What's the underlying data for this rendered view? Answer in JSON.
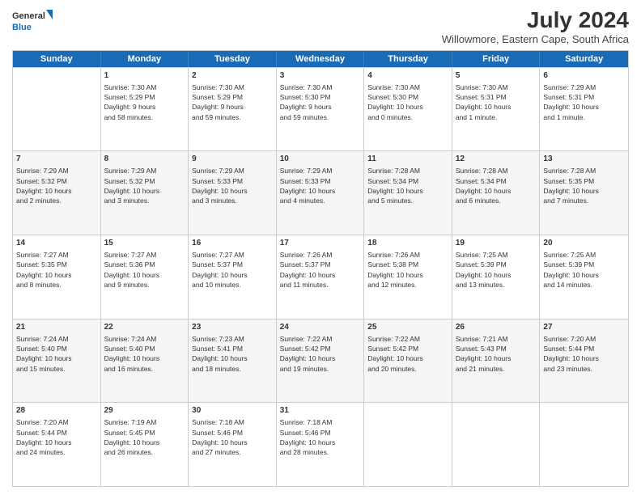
{
  "header": {
    "logo": {
      "line1": "General",
      "line2": "Blue"
    },
    "title": "July 2024",
    "location": "Willowmore, Eastern Cape, South Africa"
  },
  "days_of_week": [
    "Sunday",
    "Monday",
    "Tuesday",
    "Wednesday",
    "Thursday",
    "Friday",
    "Saturday"
  ],
  "weeks": [
    [
      {
        "day": "",
        "info": ""
      },
      {
        "day": "1",
        "info": "Sunrise: 7:30 AM\nSunset: 5:29 PM\nDaylight: 9 hours\nand 58 minutes."
      },
      {
        "day": "2",
        "info": "Sunrise: 7:30 AM\nSunset: 5:29 PM\nDaylight: 9 hours\nand 59 minutes."
      },
      {
        "day": "3",
        "info": "Sunrise: 7:30 AM\nSunset: 5:30 PM\nDaylight: 9 hours\nand 59 minutes."
      },
      {
        "day": "4",
        "info": "Sunrise: 7:30 AM\nSunset: 5:30 PM\nDaylight: 10 hours\nand 0 minutes."
      },
      {
        "day": "5",
        "info": "Sunrise: 7:30 AM\nSunset: 5:31 PM\nDaylight: 10 hours\nand 1 minute."
      },
      {
        "day": "6",
        "info": "Sunrise: 7:29 AM\nSunset: 5:31 PM\nDaylight: 10 hours\nand 1 minute."
      }
    ],
    [
      {
        "day": "7",
        "info": "Sunrise: 7:29 AM\nSunset: 5:32 PM\nDaylight: 10 hours\nand 2 minutes."
      },
      {
        "day": "8",
        "info": "Sunrise: 7:29 AM\nSunset: 5:32 PM\nDaylight: 10 hours\nand 3 minutes."
      },
      {
        "day": "9",
        "info": "Sunrise: 7:29 AM\nSunset: 5:33 PM\nDaylight: 10 hours\nand 3 minutes."
      },
      {
        "day": "10",
        "info": "Sunrise: 7:29 AM\nSunset: 5:33 PM\nDaylight: 10 hours\nand 4 minutes."
      },
      {
        "day": "11",
        "info": "Sunrise: 7:28 AM\nSunset: 5:34 PM\nDaylight: 10 hours\nand 5 minutes."
      },
      {
        "day": "12",
        "info": "Sunrise: 7:28 AM\nSunset: 5:34 PM\nDaylight: 10 hours\nand 6 minutes."
      },
      {
        "day": "13",
        "info": "Sunrise: 7:28 AM\nSunset: 5:35 PM\nDaylight: 10 hours\nand 7 minutes."
      }
    ],
    [
      {
        "day": "14",
        "info": "Sunrise: 7:27 AM\nSunset: 5:35 PM\nDaylight: 10 hours\nand 8 minutes."
      },
      {
        "day": "15",
        "info": "Sunrise: 7:27 AM\nSunset: 5:36 PM\nDaylight: 10 hours\nand 9 minutes."
      },
      {
        "day": "16",
        "info": "Sunrise: 7:27 AM\nSunset: 5:37 PM\nDaylight: 10 hours\nand 10 minutes."
      },
      {
        "day": "17",
        "info": "Sunrise: 7:26 AM\nSunset: 5:37 PM\nDaylight: 10 hours\nand 11 minutes."
      },
      {
        "day": "18",
        "info": "Sunrise: 7:26 AM\nSunset: 5:38 PM\nDaylight: 10 hours\nand 12 minutes."
      },
      {
        "day": "19",
        "info": "Sunrise: 7:25 AM\nSunset: 5:39 PM\nDaylight: 10 hours\nand 13 minutes."
      },
      {
        "day": "20",
        "info": "Sunrise: 7:25 AM\nSunset: 5:39 PM\nDaylight: 10 hours\nand 14 minutes."
      }
    ],
    [
      {
        "day": "21",
        "info": "Sunrise: 7:24 AM\nSunset: 5:40 PM\nDaylight: 10 hours\nand 15 minutes."
      },
      {
        "day": "22",
        "info": "Sunrise: 7:24 AM\nSunset: 5:40 PM\nDaylight: 10 hours\nand 16 minutes."
      },
      {
        "day": "23",
        "info": "Sunrise: 7:23 AM\nSunset: 5:41 PM\nDaylight: 10 hours\nand 18 minutes."
      },
      {
        "day": "24",
        "info": "Sunrise: 7:22 AM\nSunset: 5:42 PM\nDaylight: 10 hours\nand 19 minutes."
      },
      {
        "day": "25",
        "info": "Sunrise: 7:22 AM\nSunset: 5:42 PM\nDaylight: 10 hours\nand 20 minutes."
      },
      {
        "day": "26",
        "info": "Sunrise: 7:21 AM\nSunset: 5:43 PM\nDaylight: 10 hours\nand 21 minutes."
      },
      {
        "day": "27",
        "info": "Sunrise: 7:20 AM\nSunset: 5:44 PM\nDaylight: 10 hours\nand 23 minutes."
      }
    ],
    [
      {
        "day": "28",
        "info": "Sunrise: 7:20 AM\nSunset: 5:44 PM\nDaylight: 10 hours\nand 24 minutes."
      },
      {
        "day": "29",
        "info": "Sunrise: 7:19 AM\nSunset: 5:45 PM\nDaylight: 10 hours\nand 26 minutes."
      },
      {
        "day": "30",
        "info": "Sunrise: 7:18 AM\nSunset: 5:46 PM\nDaylight: 10 hours\nand 27 minutes."
      },
      {
        "day": "31",
        "info": "Sunrise: 7:18 AM\nSunset: 5:46 PM\nDaylight: 10 hours\nand 28 minutes."
      },
      {
        "day": "",
        "info": ""
      },
      {
        "day": "",
        "info": ""
      },
      {
        "day": "",
        "info": ""
      }
    ]
  ]
}
